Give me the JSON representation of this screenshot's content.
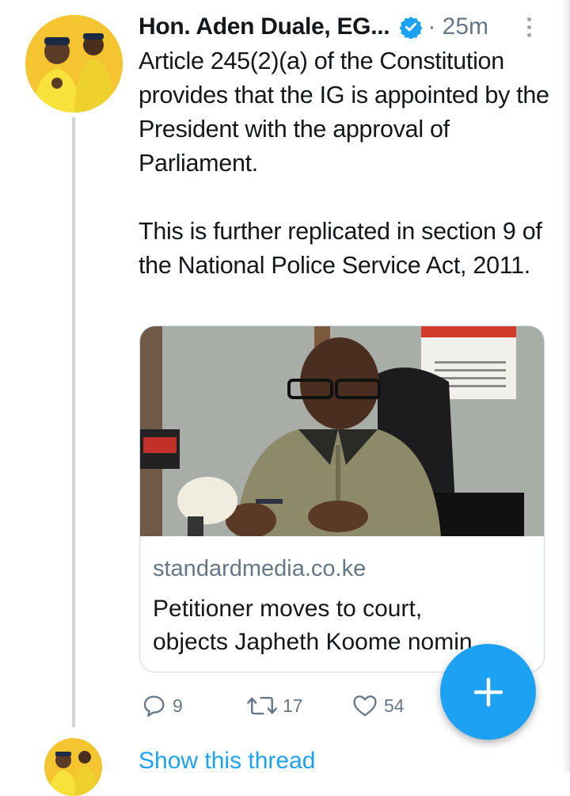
{
  "tweet": {
    "author": "Hon. Aden Duale, EG...",
    "time": "· 25m",
    "paragraphs": [
      "Article 245(2)(a) of the Constitution provides that the IG is appointed by the President with the approval of Parliament.",
      "This is further replicated in section 9 of the National Police Service Act, 2011."
    ],
    "card": {
      "domain": "standardmedia.co.ke",
      "title_line1": "Petitioner moves to court,",
      "title_line2": "objects Japheth Koome nomin..."
    },
    "actions": {
      "replies": "9",
      "retweets": "17",
      "likes": "54"
    }
  },
  "thread": {
    "show_label": "Show this thread"
  },
  "icons": [
    "verified-badge-icon",
    "more-options-icon",
    "reply-icon",
    "retweet-icon",
    "like-icon",
    "plus-icon"
  ],
  "colors": {
    "accent": "#1da1f2",
    "text": "#14171a",
    "muted": "#657786",
    "avatar_bg": "#f2c12e"
  }
}
